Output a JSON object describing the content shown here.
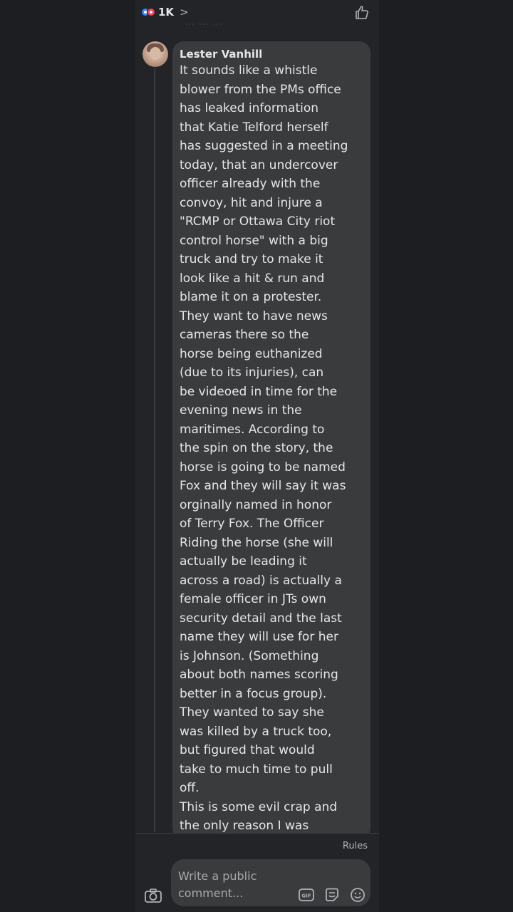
{
  "header": {
    "reaction_count": "1K",
    "chevron": ">",
    "faded_text": "··· ··· ···"
  },
  "comment": {
    "author": "Lester Vanhill",
    "lines": [
      "It sounds like a whistle",
      "blower from the PMs office",
      "has leaked information",
      "that Katie Telford herself",
      "has suggested in a meeting",
      "today, that an undercover",
      "officer already with the",
      "convoy, hit and injure a",
      "\"RCMP or Ottawa City riot",
      "control horse\" with a big",
      "truck and try to make it",
      "look like a hit & run and",
      "blame it on a protester.",
      "They want to have news",
      "cameras there so the",
      "horse being euthanized",
      "(due to its injuries), can",
      "be videoed in time for the",
      "evening news in the",
      "maritimes. According to",
      "the spin on the story, the",
      "horse is going to be named",
      "Fox and they will say it was",
      "orginally named in honor",
      "of Terry Fox. The Officer",
      "Riding the horse (she will",
      "actually be leading it",
      "across a road) is actually a",
      "female officer in JTs own",
      "security detail and the last",
      "name they will use for her",
      "is Johnson. (Something",
      "about both names scoring",
      "better in a focus group).",
      "They wanted to say she",
      "was killed by a truck too,",
      "but figured that would",
      "take to much time to pull",
      "off.",
      "This is some evil crap and",
      "the only reason I was"
    ]
  },
  "footer": {
    "rules_label": "Rules",
    "input_placeholder": "Write a public comment..."
  },
  "icons": {
    "like": "like-icon",
    "camera": "camera-icon",
    "gif": "gif-icon",
    "sticker": "sticker-icon",
    "emoji": "emoji-icon"
  },
  "colors": {
    "background": "#1d1e21",
    "panel": "#232427",
    "bubble": "#3a3b3c",
    "text": "#e4e6eb",
    "muted": "#b0b3b8",
    "like_blue": "#2d88ff",
    "love_red": "#f33e58"
  }
}
